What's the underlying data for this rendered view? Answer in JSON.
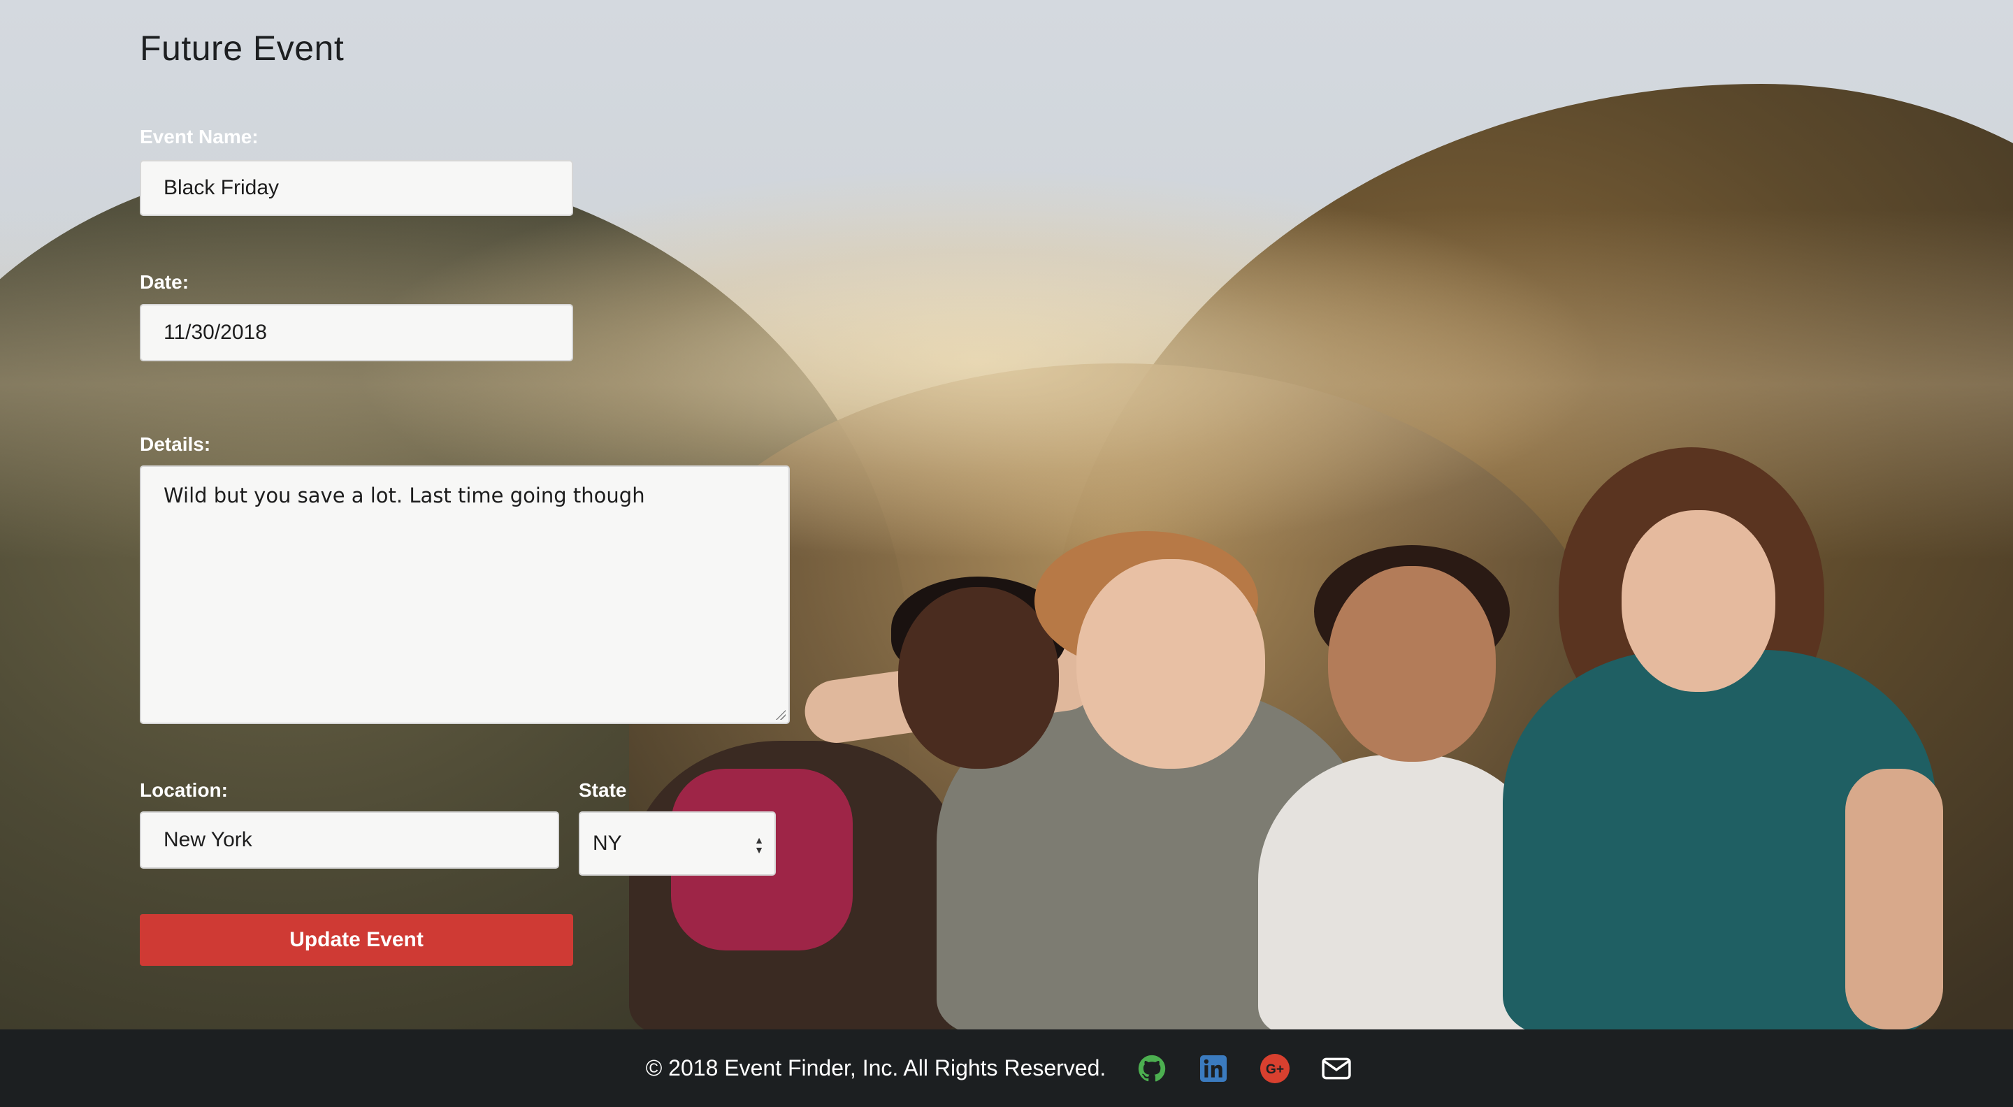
{
  "page": {
    "title": "Future Event"
  },
  "form": {
    "event_name": {
      "label": "Event Name:",
      "value": "Black Friday"
    },
    "date": {
      "label": "Date:",
      "value": "11/30/2018"
    },
    "details": {
      "label": "Details:",
      "value": "Wild but you save a lot. Last time going though"
    },
    "location": {
      "label": "Location:",
      "value": "New York"
    },
    "state": {
      "label": "State",
      "value": "NY"
    },
    "submit_label": "Update Event"
  },
  "footer": {
    "copyright": "© 2018 Event Finder, Inc.  All Rights Reserved.",
    "icons": [
      {
        "name": "github-icon",
        "color": "#4caf50"
      },
      {
        "name": "linkedin-icon",
        "color": "#3b7bbf"
      },
      {
        "name": "google-plus-icon",
        "color": "#d8402f"
      },
      {
        "name": "email-icon",
        "color": "#ffffff"
      }
    ]
  }
}
